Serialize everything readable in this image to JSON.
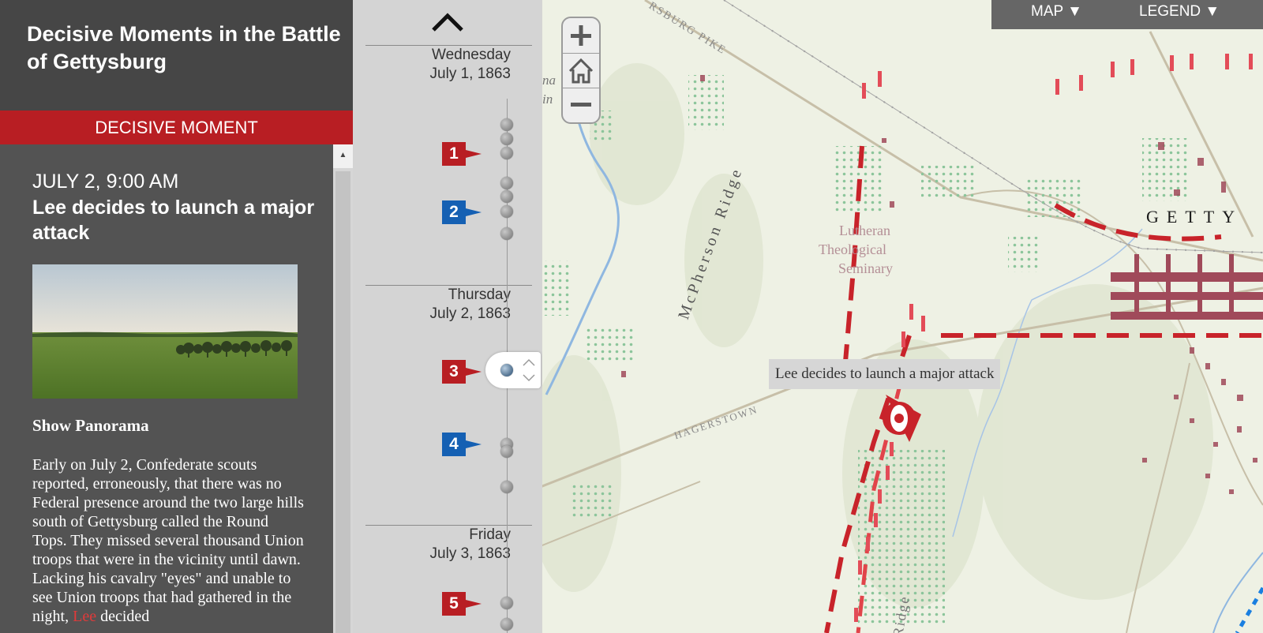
{
  "app": {
    "title": "Decisive Moments in the Battle of Gettysburg",
    "section_label": "DECISIVE MOMENT"
  },
  "moment": {
    "time": "JULY 2, 9:00 AM",
    "title": "Lee decides to launch a major attack",
    "show_panorama": "Show Panorama",
    "body_before": "Early on July 2, Confederate scouts reported, erroneously, that there was no Federal presence around the two large hills south of Gettysburg called the Round Tops. They missed several thousand Union troops that were in the vicinity until dawn. Lacking his cavalry \"eyes\" and unable to see Union troops that had gathered in the night, ",
    "body_highlight": "Lee",
    "body_after": " decided"
  },
  "timeline": {
    "days": [
      {
        "weekday": "Wednesday",
        "date": "July 1, 1863"
      },
      {
        "weekday": "Thursday",
        "date": "July 2, 1863"
      },
      {
        "weekday": "Friday",
        "date": "July 3, 1863"
      }
    ],
    "markers": [
      {
        "number": "1",
        "color": "#b81e23"
      },
      {
        "number": "2",
        "color": "#1560b3"
      },
      {
        "number": "3",
        "color": "#b81e23"
      },
      {
        "number": "4",
        "color": "#1560b3"
      },
      {
        "number": "5",
        "color": "#b81e23"
      }
    ]
  },
  "map": {
    "menu_map": "MAP ▼",
    "menu_legend": "LEGEND ▼",
    "tooltip": "Lee decides to launch a major attack",
    "labels": {
      "mcpherson": "McPherson Ridge",
      "seminary_1": "Lutheran",
      "seminary_2": "Theological",
      "seminary_3": "Seminary",
      "town": "GETTY",
      "pike": "RSBURG PIKE",
      "hagerstown": "HAGERSTOWN",
      "ridge": "Ridge",
      "edge_1": "na",
      "edge_2": "in"
    }
  },
  "colors": {
    "confederate": "#c8232a",
    "union": "#1560b3",
    "panel_dark": "#464646",
    "accent": "#b81e23"
  },
  "icons": {
    "timeline_up": "chevron-up-icon",
    "zoom_in": "plus-icon",
    "home": "home-icon",
    "zoom_out": "minus-icon",
    "moment_marker": "eye-icon",
    "advance": "arrow-icon"
  }
}
